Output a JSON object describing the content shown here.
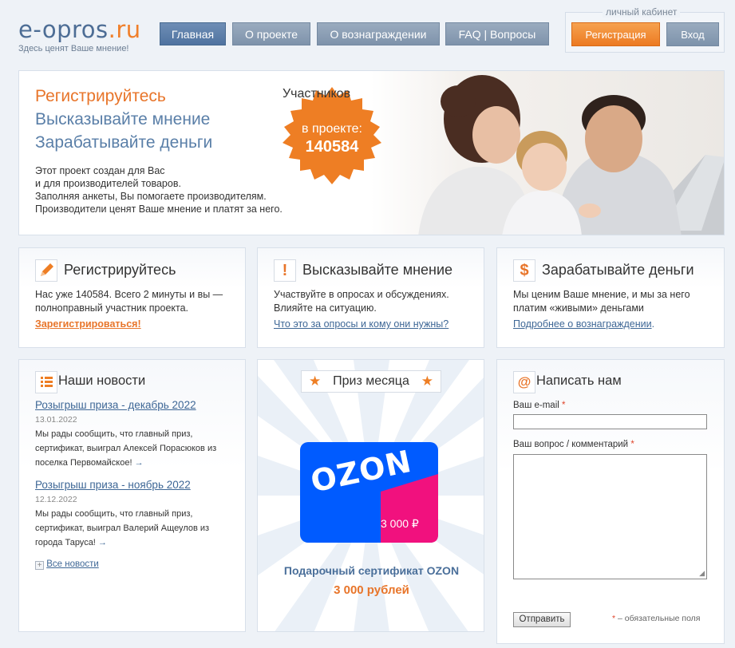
{
  "header": {
    "logo_main": "e-opros",
    "logo_suffix": ".ru",
    "tagline": "Здесь ценят Ваше мнение!",
    "nav": [
      {
        "label": "Главная",
        "active": true
      },
      {
        "label": "О проекте"
      },
      {
        "label": "О вознаграждении"
      },
      {
        "label": "FAQ | Вопросы"
      }
    ],
    "cabinet": {
      "legend": "личный кабинет",
      "register_label": "Регистрация",
      "login_label": "Вход"
    }
  },
  "hero": {
    "line1": "Регистрируйтесь",
    "line2": "Высказывайте мнение",
    "line3": "Зарабатывайте деньги",
    "desc": [
      "Этот проект создан для Вас",
      "и для производителей товаров.",
      "Заполняя анкеты, Вы помогаете производителям.",
      "Производители ценят Ваше мнение и платят за него."
    ],
    "badge_line1": "Участников",
    "badge_line2": "в проекте:",
    "badge_count": "140584"
  },
  "features": [
    {
      "icon": "pencil-icon",
      "title": "Регистрируйтесь",
      "text": "Нас уже 140584. Всего 2 минуты и вы — полноправный участник проекта.",
      "link": "Зарегистрироваться!"
    },
    {
      "icon": "exclamation-icon",
      "title": "Высказывайте мнение",
      "text": "Участвуйте в опросах и обсуждениях. Влияйте на ситуацию.",
      "link": "Что это за опросы и кому они нужны?"
    },
    {
      "icon": "dollar-icon",
      "title": "Зарабатывайте деньги",
      "text": "Мы ценим Ваше мнение, и мы за него платим «живыми» деньгами",
      "link": "Подробнее о вознаграждении",
      "link_suffix": "."
    }
  ],
  "news": {
    "title": "Наши новости",
    "items": [
      {
        "title": "Розыгрыш приза - декабрь 2022",
        "date": "13.01.2022",
        "text": "Мы рады сообщить, что главный приз, сертификат, выиграл Алексей Порасюков из поселка Первомайское!",
        "arrow": "→"
      },
      {
        "title": "Розыгрыш приза - ноябрь 2022",
        "date": "12.12.2022",
        "text": "Мы рады сообщить, что главный приз, сертификат, выиграл Валерий Ащеулов из города Таруса!",
        "arrow": "→"
      }
    ],
    "all_label": "Все новости"
  },
  "prize": {
    "title": "Приз месяца",
    "card_brand": "OZON",
    "card_amount": "3 000 ₽",
    "caption": "Подарочный сертификат OZON",
    "amount": "3 000 рублей"
  },
  "contact": {
    "title": "Написать нам",
    "email_label": "Ваш e-mail",
    "question_label": "Ваш вопрос / комментарий",
    "required_mark": "*",
    "send_label": "Отправить",
    "required_note": "– обязательные поля"
  },
  "colors": {
    "accent_orange": "#e8752a",
    "brand_blue": "#5a7fa8",
    "ozon_blue": "#005bff",
    "ozon_pink": "#f1117e"
  }
}
